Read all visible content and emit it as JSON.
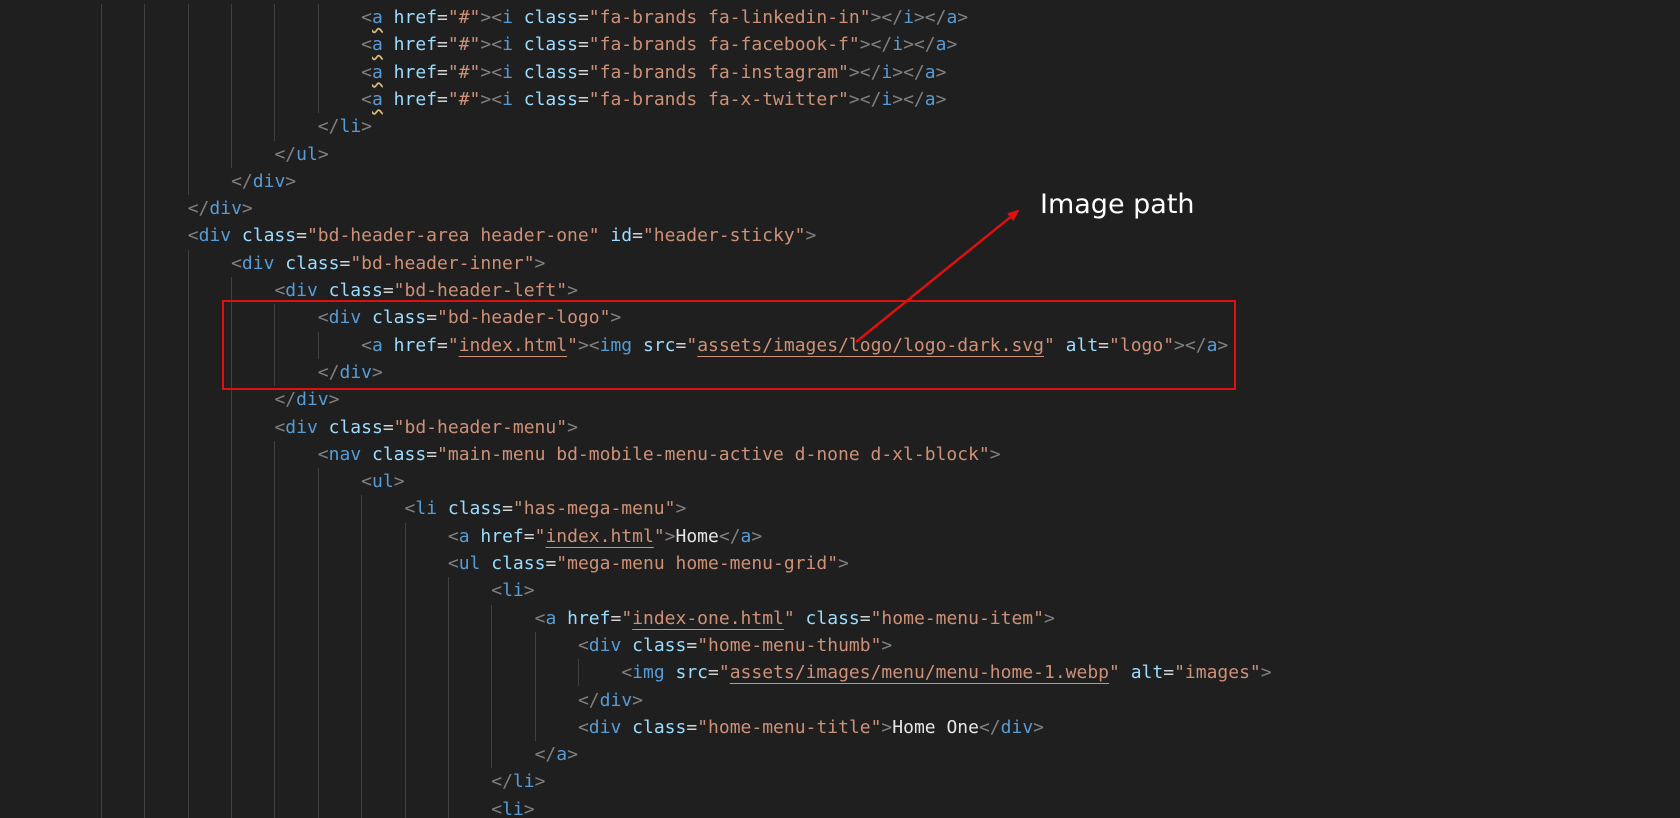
{
  "editor": {
    "language": "html",
    "lines": [
      {
        "indent": 6,
        "tokens": [
          [
            "b",
            "<"
          ],
          [
            "t",
            "a",
            "squiggle"
          ],
          [
            "a",
            " href"
          ],
          [
            "e",
            "="
          ],
          [
            "s",
            "\"#\""
          ],
          [
            "b",
            "><"
          ],
          [
            "t",
            "i"
          ],
          [
            "a",
            " class"
          ],
          [
            "e",
            "="
          ],
          [
            "s",
            "\"fa-brands fa-linkedin-in\""
          ],
          [
            "b",
            "></"
          ],
          [
            "t",
            "i"
          ],
          [
            "b",
            "></"
          ],
          [
            "t",
            "a"
          ],
          [
            "b",
            ">"
          ]
        ]
      },
      {
        "indent": 6,
        "tokens": [
          [
            "b",
            "<"
          ],
          [
            "t",
            "a",
            "squiggle"
          ],
          [
            "a",
            " href"
          ],
          [
            "e",
            "="
          ],
          [
            "s",
            "\"#\""
          ],
          [
            "b",
            "><"
          ],
          [
            "t",
            "i"
          ],
          [
            "a",
            " class"
          ],
          [
            "e",
            "="
          ],
          [
            "s",
            "\"fa-brands fa-facebook-f\""
          ],
          [
            "b",
            "></"
          ],
          [
            "t",
            "i"
          ],
          [
            "b",
            "></"
          ],
          [
            "t",
            "a"
          ],
          [
            "b",
            ">"
          ]
        ]
      },
      {
        "indent": 6,
        "tokens": [
          [
            "b",
            "<"
          ],
          [
            "t",
            "a",
            "squiggle"
          ],
          [
            "a",
            " href"
          ],
          [
            "e",
            "="
          ],
          [
            "s",
            "\"#\""
          ],
          [
            "b",
            "><"
          ],
          [
            "t",
            "i"
          ],
          [
            "a",
            " class"
          ],
          [
            "e",
            "="
          ],
          [
            "s",
            "\"fa-brands fa-instagram\""
          ],
          [
            "b",
            "></"
          ],
          [
            "t",
            "i"
          ],
          [
            "b",
            "></"
          ],
          [
            "t",
            "a"
          ],
          [
            "b",
            ">"
          ]
        ]
      },
      {
        "indent": 6,
        "tokens": [
          [
            "b",
            "<"
          ],
          [
            "t",
            "a",
            "squiggle"
          ],
          [
            "a",
            " href"
          ],
          [
            "e",
            "="
          ],
          [
            "s",
            "\"#\""
          ],
          [
            "b",
            "><"
          ],
          [
            "t",
            "i"
          ],
          [
            "a",
            " class"
          ],
          [
            "e",
            "="
          ],
          [
            "s",
            "\"fa-brands fa-x-twitter\""
          ],
          [
            "b",
            "></"
          ],
          [
            "t",
            "i"
          ],
          [
            "b",
            "></"
          ],
          [
            "t",
            "a"
          ],
          [
            "b",
            ">"
          ]
        ]
      },
      {
        "indent": 5,
        "tokens": [
          [
            "b",
            "</"
          ],
          [
            "t",
            "li"
          ],
          [
            "b",
            ">"
          ]
        ]
      },
      {
        "indent": 4,
        "tokens": [
          [
            "b",
            "</"
          ],
          [
            "t",
            "ul"
          ],
          [
            "b",
            ">"
          ]
        ]
      },
      {
        "indent": 3,
        "tokens": [
          [
            "b",
            "</"
          ],
          [
            "t",
            "div"
          ],
          [
            "b",
            ">"
          ]
        ]
      },
      {
        "indent": 2,
        "tokens": [
          [
            "b",
            "</"
          ],
          [
            "t",
            "div"
          ],
          [
            "b",
            ">"
          ]
        ]
      },
      {
        "indent": 2,
        "tokens": [
          [
            "b",
            "<"
          ],
          [
            "t",
            "div"
          ],
          [
            "a",
            " class"
          ],
          [
            "e",
            "="
          ],
          [
            "s",
            "\"bd-header-area header-one\""
          ],
          [
            "a",
            " id"
          ],
          [
            "e",
            "="
          ],
          [
            "s",
            "\"header-sticky\""
          ],
          [
            "b",
            ">"
          ]
        ]
      },
      {
        "indent": 3,
        "tokens": [
          [
            "b",
            "<"
          ],
          [
            "t",
            "div"
          ],
          [
            "a",
            " class"
          ],
          [
            "e",
            "="
          ],
          [
            "s",
            "\"bd-header-inner\""
          ],
          [
            "b",
            ">"
          ]
        ]
      },
      {
        "indent": 4,
        "tokens": [
          [
            "b",
            "<"
          ],
          [
            "t",
            "div"
          ],
          [
            "a",
            " class"
          ],
          [
            "e",
            "="
          ],
          [
            "s",
            "\"bd-header-left\""
          ],
          [
            "b",
            ">"
          ]
        ]
      },
      {
        "indent": 5,
        "tokens": [
          [
            "b",
            "<"
          ],
          [
            "t",
            "div"
          ],
          [
            "a",
            " class"
          ],
          [
            "e",
            "="
          ],
          [
            "s",
            "\"bd-header-logo\""
          ],
          [
            "b",
            ">"
          ]
        ]
      },
      {
        "indent": 6,
        "tokens": [
          [
            "b",
            "<"
          ],
          [
            "t",
            "a"
          ],
          [
            "a",
            " href"
          ],
          [
            "e",
            "="
          ],
          [
            "s",
            "\""
          ],
          [
            "s",
            "index.html",
            "link"
          ],
          [
            "s",
            "\""
          ],
          [
            "b",
            "><"
          ],
          [
            "t",
            "img"
          ],
          [
            "a",
            " src"
          ],
          [
            "e",
            "="
          ],
          [
            "s",
            "\""
          ],
          [
            "s",
            "assets/images/logo/logo-dark.svg",
            "link"
          ],
          [
            "s",
            "\""
          ],
          [
            "a",
            " alt"
          ],
          [
            "e",
            "="
          ],
          [
            "s",
            "\"logo\""
          ],
          [
            "b",
            "></"
          ],
          [
            "t",
            "a"
          ],
          [
            "b",
            ">"
          ]
        ]
      },
      {
        "indent": 5,
        "tokens": [
          [
            "b",
            "</"
          ],
          [
            "t",
            "div"
          ],
          [
            "b",
            ">"
          ]
        ]
      },
      {
        "indent": 4,
        "tokens": [
          [
            "b",
            "</"
          ],
          [
            "t",
            "div"
          ],
          [
            "b",
            ">"
          ]
        ]
      },
      {
        "indent": 4,
        "tokens": [
          [
            "b",
            "<"
          ],
          [
            "t",
            "div"
          ],
          [
            "a",
            " class"
          ],
          [
            "e",
            "="
          ],
          [
            "s",
            "\"bd-header-menu\""
          ],
          [
            "b",
            ">"
          ]
        ]
      },
      {
        "indent": 5,
        "tokens": [
          [
            "b",
            "<"
          ],
          [
            "t",
            "nav"
          ],
          [
            "a",
            " class"
          ],
          [
            "e",
            "="
          ],
          [
            "s",
            "\"main-menu bd-mobile-menu-active d-none d-xl-block\""
          ],
          [
            "b",
            ">"
          ]
        ]
      },
      {
        "indent": 6,
        "tokens": [
          [
            "b",
            "<"
          ],
          [
            "t",
            "ul"
          ],
          [
            "b",
            ">"
          ]
        ]
      },
      {
        "indent": 7,
        "tokens": [
          [
            "b",
            "<"
          ],
          [
            "t",
            "li"
          ],
          [
            "a",
            " class"
          ],
          [
            "e",
            "="
          ],
          [
            "s",
            "\"has-mega-menu\""
          ],
          [
            "b",
            ">"
          ]
        ]
      },
      {
        "indent": 8,
        "tokens": [
          [
            "b",
            "<"
          ],
          [
            "t",
            "a"
          ],
          [
            "a",
            " href"
          ],
          [
            "e",
            "="
          ],
          [
            "s",
            "\""
          ],
          [
            "s",
            "index.html",
            "link"
          ],
          [
            "s",
            "\""
          ],
          [
            "b",
            ">"
          ],
          [
            "x",
            "Home"
          ],
          [
            "b",
            "</"
          ],
          [
            "t",
            "a"
          ],
          [
            "b",
            ">"
          ]
        ]
      },
      {
        "indent": 8,
        "tokens": [
          [
            "b",
            "<"
          ],
          [
            "t",
            "ul"
          ],
          [
            "a",
            " class"
          ],
          [
            "e",
            "="
          ],
          [
            "s",
            "\"mega-menu home-menu-grid\""
          ],
          [
            "b",
            ">"
          ]
        ]
      },
      {
        "indent": 9,
        "tokens": [
          [
            "b",
            "<"
          ],
          [
            "t",
            "li"
          ],
          [
            "b",
            ">"
          ]
        ]
      },
      {
        "indent": 10,
        "tokens": [
          [
            "b",
            "<"
          ],
          [
            "t",
            "a"
          ],
          [
            "a",
            " href"
          ],
          [
            "e",
            "="
          ],
          [
            "s",
            "\""
          ],
          [
            "s",
            "index-one.html",
            "link"
          ],
          [
            "s",
            "\""
          ],
          [
            "a",
            " class"
          ],
          [
            "e",
            "="
          ],
          [
            "s",
            "\"home-menu-item\""
          ],
          [
            "b",
            ">"
          ]
        ]
      },
      {
        "indent": 11,
        "tokens": [
          [
            "b",
            "<"
          ],
          [
            "t",
            "div"
          ],
          [
            "a",
            " class"
          ],
          [
            "e",
            "="
          ],
          [
            "s",
            "\"home-menu-thumb\""
          ],
          [
            "b",
            ">"
          ]
        ]
      },
      {
        "indent": 12,
        "tokens": [
          [
            "b",
            "<"
          ],
          [
            "t",
            "img"
          ],
          [
            "a",
            " src"
          ],
          [
            "e",
            "="
          ],
          [
            "s",
            "\""
          ],
          [
            "s",
            "assets/images/menu/menu-home-1.webp",
            "link"
          ],
          [
            "s",
            "\""
          ],
          [
            "a",
            " alt"
          ],
          [
            "e",
            "="
          ],
          [
            "s",
            "\"images\""
          ],
          [
            "b",
            ">"
          ]
        ]
      },
      {
        "indent": 11,
        "tokens": [
          [
            "b",
            "</"
          ],
          [
            "t",
            "div"
          ],
          [
            "b",
            ">"
          ]
        ]
      },
      {
        "indent": 11,
        "tokens": [
          [
            "b",
            "<"
          ],
          [
            "t",
            "div"
          ],
          [
            "a",
            " class"
          ],
          [
            "e",
            "="
          ],
          [
            "s",
            "\"home-menu-title\""
          ],
          [
            "b",
            ">"
          ],
          [
            "x",
            "Home One"
          ],
          [
            "b",
            "</"
          ],
          [
            "t",
            "div"
          ],
          [
            "b",
            ">"
          ]
        ]
      },
      {
        "indent": 10,
        "tokens": [
          [
            "b",
            "</"
          ],
          [
            "t",
            "a"
          ],
          [
            "b",
            ">"
          ]
        ]
      },
      {
        "indent": 9,
        "tokens": [
          [
            "b",
            "</"
          ],
          [
            "t",
            "li"
          ],
          [
            "b",
            ">"
          ]
        ]
      },
      {
        "indent": 9,
        "tokens": [
          [
            "b",
            "<"
          ],
          [
            "t",
            "li"
          ],
          [
            "b",
            ">"
          ]
        ]
      }
    ]
  },
  "annotation": {
    "label": "Image path",
    "box_color": "#e01010",
    "arrow_color": "#e01010"
  },
  "colors": {
    "background": "#1f1f1f",
    "tag": "#569cd6",
    "attribute": "#9cdcfe",
    "string": "#ce9178",
    "bracket": "#808080",
    "text": "#e6e6e6"
  }
}
